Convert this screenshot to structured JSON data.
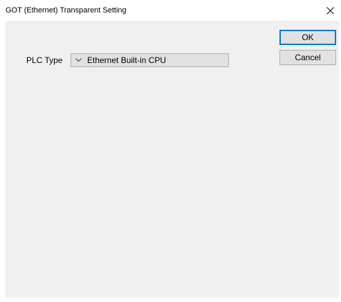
{
  "window": {
    "title": "GOT (Ethernet) Transparent Setting",
    "close_icon": "close-icon"
  },
  "form": {
    "plc_type_label": "PLC Type",
    "plc_type_value": "Ethernet Built-in CPU",
    "dropdown_icon": "chevron-down-icon"
  },
  "buttons": {
    "ok": "OK",
    "cancel": "Cancel"
  },
  "colors": {
    "client_bg": "#f0f0f0",
    "button_bg": "#e1e1e1",
    "button_border": "#adadad",
    "focus_border": "#0078d7"
  }
}
